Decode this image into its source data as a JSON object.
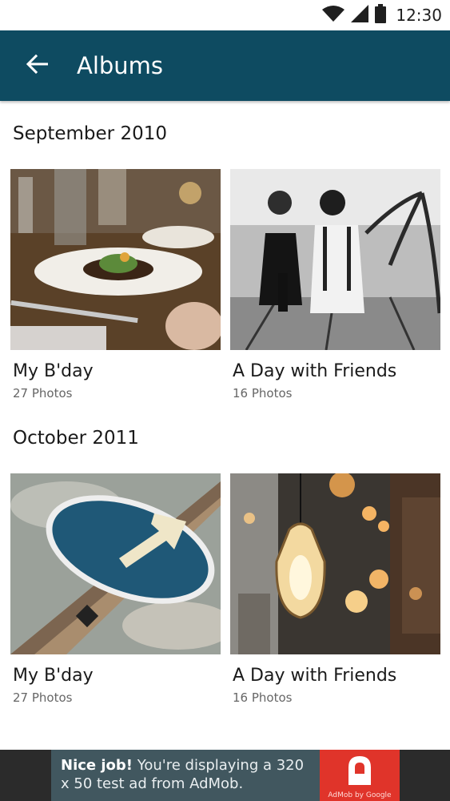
{
  "status_bar": {
    "time": "12:30"
  },
  "app_bar": {
    "title": "Albums"
  },
  "sections": [
    {
      "title": "September 2010",
      "albums": [
        {
          "title": "My B'day",
          "count": "27 Photos"
        },
        {
          "title": "A Day with Friends",
          "count": "16 Photos"
        }
      ]
    },
    {
      "title": "October 2011",
      "albums": [
        {
          "title": "My B'day",
          "count": "27 Photos"
        },
        {
          "title": "A Day with Friends",
          "count": "16 Photos"
        }
      ]
    }
  ],
  "ad": {
    "headline": "Nice job!",
    "body": " You're displaying a 320 x 50 test ad from AdMob.",
    "brand": "AdMob by Google"
  },
  "colors": {
    "app_bar": "#0e4b61",
    "ad_background": "#41575f",
    "ad_logo": "#e0342a"
  },
  "icons": [
    "wifi-icon",
    "signal-icon",
    "battery-icon",
    "back-arrow-icon",
    "admob-logo-icon"
  ]
}
